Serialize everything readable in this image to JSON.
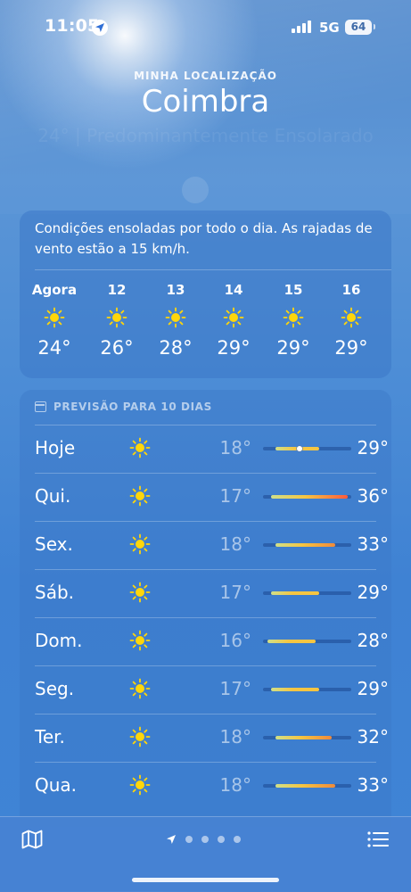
{
  "status_bar": {
    "time": "11:05",
    "network": "5G",
    "battery": "64"
  },
  "header": {
    "location_label": "MINHA LOCALIZAÇÃO",
    "city": "Coimbra",
    "condition_faded": "24° | Predominantemente Ensolarado"
  },
  "hourly": {
    "summary": "Condições ensoladas por todo o dia. As rajadas de vento estão a 15 km/h.",
    "items": [
      {
        "label": "Agora",
        "icon": "sun-icon",
        "temp": "24°"
      },
      {
        "label": "12",
        "icon": "sun-icon",
        "temp": "26°"
      },
      {
        "label": "13",
        "icon": "sun-icon",
        "temp": "28°"
      },
      {
        "label": "14",
        "icon": "sun-icon",
        "temp": "29°"
      },
      {
        "label": "15",
        "icon": "sun-icon",
        "temp": "29°"
      },
      {
        "label": "16",
        "icon": "sun-icon",
        "temp": "29°"
      }
    ]
  },
  "forecast": {
    "title": "PREVISÃO PARA 10 DIAS",
    "range_min": 15,
    "range_max": 37,
    "current_temp": 24,
    "days": [
      {
        "day": "Hoje",
        "icon": "sun-icon",
        "low": "18°",
        "high": "29°",
        "low_value": 18,
        "high_value": 29
      },
      {
        "day": "Qui.",
        "icon": "sun-icon",
        "low": "17°",
        "high": "36°",
        "low_value": 17,
        "high_value": 36
      },
      {
        "day": "Sex.",
        "icon": "sun-icon",
        "low": "18°",
        "high": "33°",
        "low_value": 18,
        "high_value": 33
      },
      {
        "day": "Sáb.",
        "icon": "sun-icon",
        "low": "17°",
        "high": "29°",
        "low_value": 17,
        "high_value": 29
      },
      {
        "day": "Dom.",
        "icon": "sun-icon",
        "low": "16°",
        "high": "28°",
        "low_value": 16,
        "high_value": 28
      },
      {
        "day": "Seg.",
        "icon": "sun-icon",
        "low": "17°",
        "high": "29°",
        "low_value": 17,
        "high_value": 29
      },
      {
        "day": "Ter.",
        "icon": "sun-icon",
        "low": "18°",
        "high": "32°",
        "low_value": 18,
        "high_value": 32
      },
      {
        "day": "Qua.",
        "icon": "sun-icon",
        "low": "18°",
        "high": "33°",
        "low_value": 18,
        "high_value": 33
      }
    ]
  },
  "colors": {
    "sun": "#ffd60a",
    "bar_warm": "#f5c542",
    "bar_hot": "#ff5a3c",
    "bar_cool": "#cfe08a"
  },
  "bottom_bar": {
    "left_icon": "map-icon",
    "right_icon": "list-icon",
    "page_count": 5,
    "active_page": 0
  }
}
